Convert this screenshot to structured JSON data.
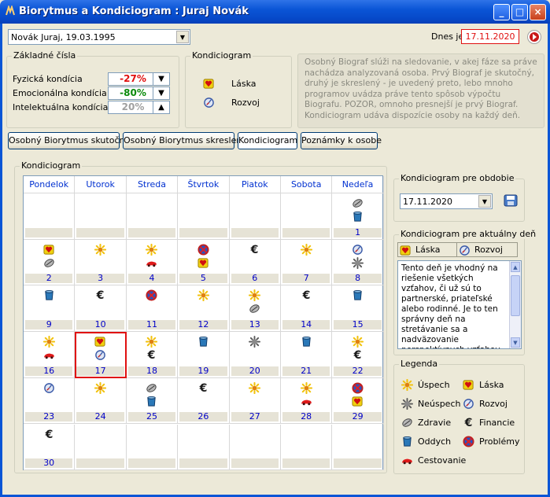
{
  "window": {
    "title": "Biorytmus a Kondiciogram : Juraj Novák"
  },
  "person_select": {
    "value": "Novák Juraj, 19.03.1995"
  },
  "today": {
    "label": "Dnes je",
    "value": "17.11.2020"
  },
  "basic": {
    "title": "Základné čísla",
    "rows": [
      {
        "label": "Fyzická kondícia",
        "value": "-27%",
        "color": "#e01010",
        "arrow": "▼"
      },
      {
        "label": "Emocionálna kondícia",
        "value": "-80%",
        "color": "#0a8a0a",
        "arrow": "▼"
      },
      {
        "label": "Intelektuálna kondícia",
        "value": "20%",
        "color": "#a0a0a0",
        "arrow": "▲"
      }
    ]
  },
  "kondi_box": {
    "title": "Kondiciogram",
    "items": [
      {
        "icon": "laska",
        "label": "Láska"
      },
      {
        "icon": "rozvoj",
        "label": "Rozvoj"
      }
    ]
  },
  "info_text": "Osobný Biograf slúži na sledovanie, v akej fáze sa práve nachádza analyzovaná osoba. Prvý Biograf je skutočný, druhý je skreslený - je uvedený preto, lebo mnoho programov uvádza práve tento spôsob výpočtu Biografu. POZOR, omnoho presnejší je prvý Biograf. Kondiciogram udáva dispozície osoby na každý deň.",
  "tabs": [
    "Osobný Biorytmus skutočný",
    "Osobný Biorytmus skreslený",
    "Kondiciogram",
    "Poznámky k osobe"
  ],
  "calendar": {
    "title": "Kondiciogram",
    "days": [
      "Pondelok",
      "Utorok",
      "Streda",
      "Štvrtok",
      "Piatok",
      "Sobota",
      "Nedeľa"
    ],
    "selected": "17",
    "weeks": [
      [
        null,
        null,
        null,
        null,
        null,
        null,
        {
          "n": "1",
          "icons": [
            "zdravie",
            "oddych"
          ]
        }
      ],
      [
        {
          "n": "2",
          "icons": [
            "laska",
            "zdravie"
          ]
        },
        {
          "n": "3",
          "icons": [
            "uspech"
          ]
        },
        {
          "n": "4",
          "icons": [
            "uspech",
            "cestovanie"
          ]
        },
        {
          "n": "5",
          "icons": [
            "problemy",
            "laska"
          ]
        },
        {
          "n": "6",
          "icons": [
            "financie"
          ]
        },
        {
          "n": "7",
          "icons": [
            "uspech"
          ]
        },
        {
          "n": "8",
          "icons": [
            "rozvoj",
            "neuspech"
          ]
        }
      ],
      [
        {
          "n": "9",
          "icons": [
            "oddych"
          ]
        },
        {
          "n": "10",
          "icons": [
            "financie"
          ]
        },
        {
          "n": "11",
          "icons": [
            "problemy"
          ]
        },
        {
          "n": "12",
          "icons": [
            "uspech"
          ]
        },
        {
          "n": "13",
          "icons": [
            "uspech",
            "zdravie"
          ]
        },
        {
          "n": "14",
          "icons": [
            "financie"
          ]
        },
        {
          "n": "15",
          "icons": [
            "oddych"
          ]
        }
      ],
      [
        {
          "n": "16",
          "icons": [
            "uspech",
            "cestovanie"
          ]
        },
        {
          "n": "17",
          "icons": [
            "laska",
            "rozvoj"
          ]
        },
        {
          "n": "18",
          "icons": [
            "uspech",
            "financie"
          ]
        },
        {
          "n": "19",
          "icons": [
            "oddych"
          ]
        },
        {
          "n": "20",
          "icons": [
            "neuspech"
          ]
        },
        {
          "n": "21",
          "icons": [
            "oddych"
          ]
        },
        {
          "n": "22",
          "icons": [
            "uspech",
            "financie"
          ]
        }
      ],
      [
        {
          "n": "23",
          "icons": [
            "rozvoj"
          ]
        },
        {
          "n": "24",
          "icons": [
            "uspech"
          ]
        },
        {
          "n": "25",
          "icons": [
            "zdravie",
            "oddych"
          ]
        },
        {
          "n": "26",
          "icons": [
            "financie"
          ]
        },
        {
          "n": "27",
          "icons": [
            "uspech"
          ]
        },
        {
          "n": "28",
          "icons": [
            "uspech",
            "cestovanie"
          ]
        },
        {
          "n": "29",
          "icons": [
            "problemy",
            "laska"
          ]
        }
      ],
      [
        {
          "n": "30",
          "icons": [
            "financie"
          ]
        },
        null,
        null,
        null,
        null,
        null,
        null
      ]
    ]
  },
  "period": {
    "title": "Kondiciogram pre obdobie",
    "value": "17.11.2020"
  },
  "day_box": {
    "title": "Kondiciogram pre aktuálny deň",
    "items": [
      {
        "icon": "laska",
        "label": "Láska"
      },
      {
        "icon": "rozvoj",
        "label": "Rozvoj"
      }
    ],
    "text": "Tento deň je vhodný na riešenie všetkých vzťahov, či už sú to partnerské, priateľské alebo rodinné. Je to ten správny deň na stretávanie sa a nadväzovanie perspektívnych vzťahov. Môžete stretnúť niekoho"
  },
  "legend": {
    "title": "Legenda",
    "items": [
      {
        "icon": "uspech",
        "label": "Úspech"
      },
      {
        "icon": "laska",
        "label": "Láska"
      },
      {
        "icon": "neuspech",
        "label": "Neúspech"
      },
      {
        "icon": "rozvoj",
        "label": "Rozvoj"
      },
      {
        "icon": "zdravie",
        "label": "Zdravie"
      },
      {
        "icon": "financie",
        "label": "Financie"
      },
      {
        "icon": "oddych",
        "label": "Oddych"
      },
      {
        "icon": "problemy",
        "label": "Problémy"
      },
      {
        "icon": "cestovanie",
        "label": "Cestovanie"
      }
    ]
  }
}
